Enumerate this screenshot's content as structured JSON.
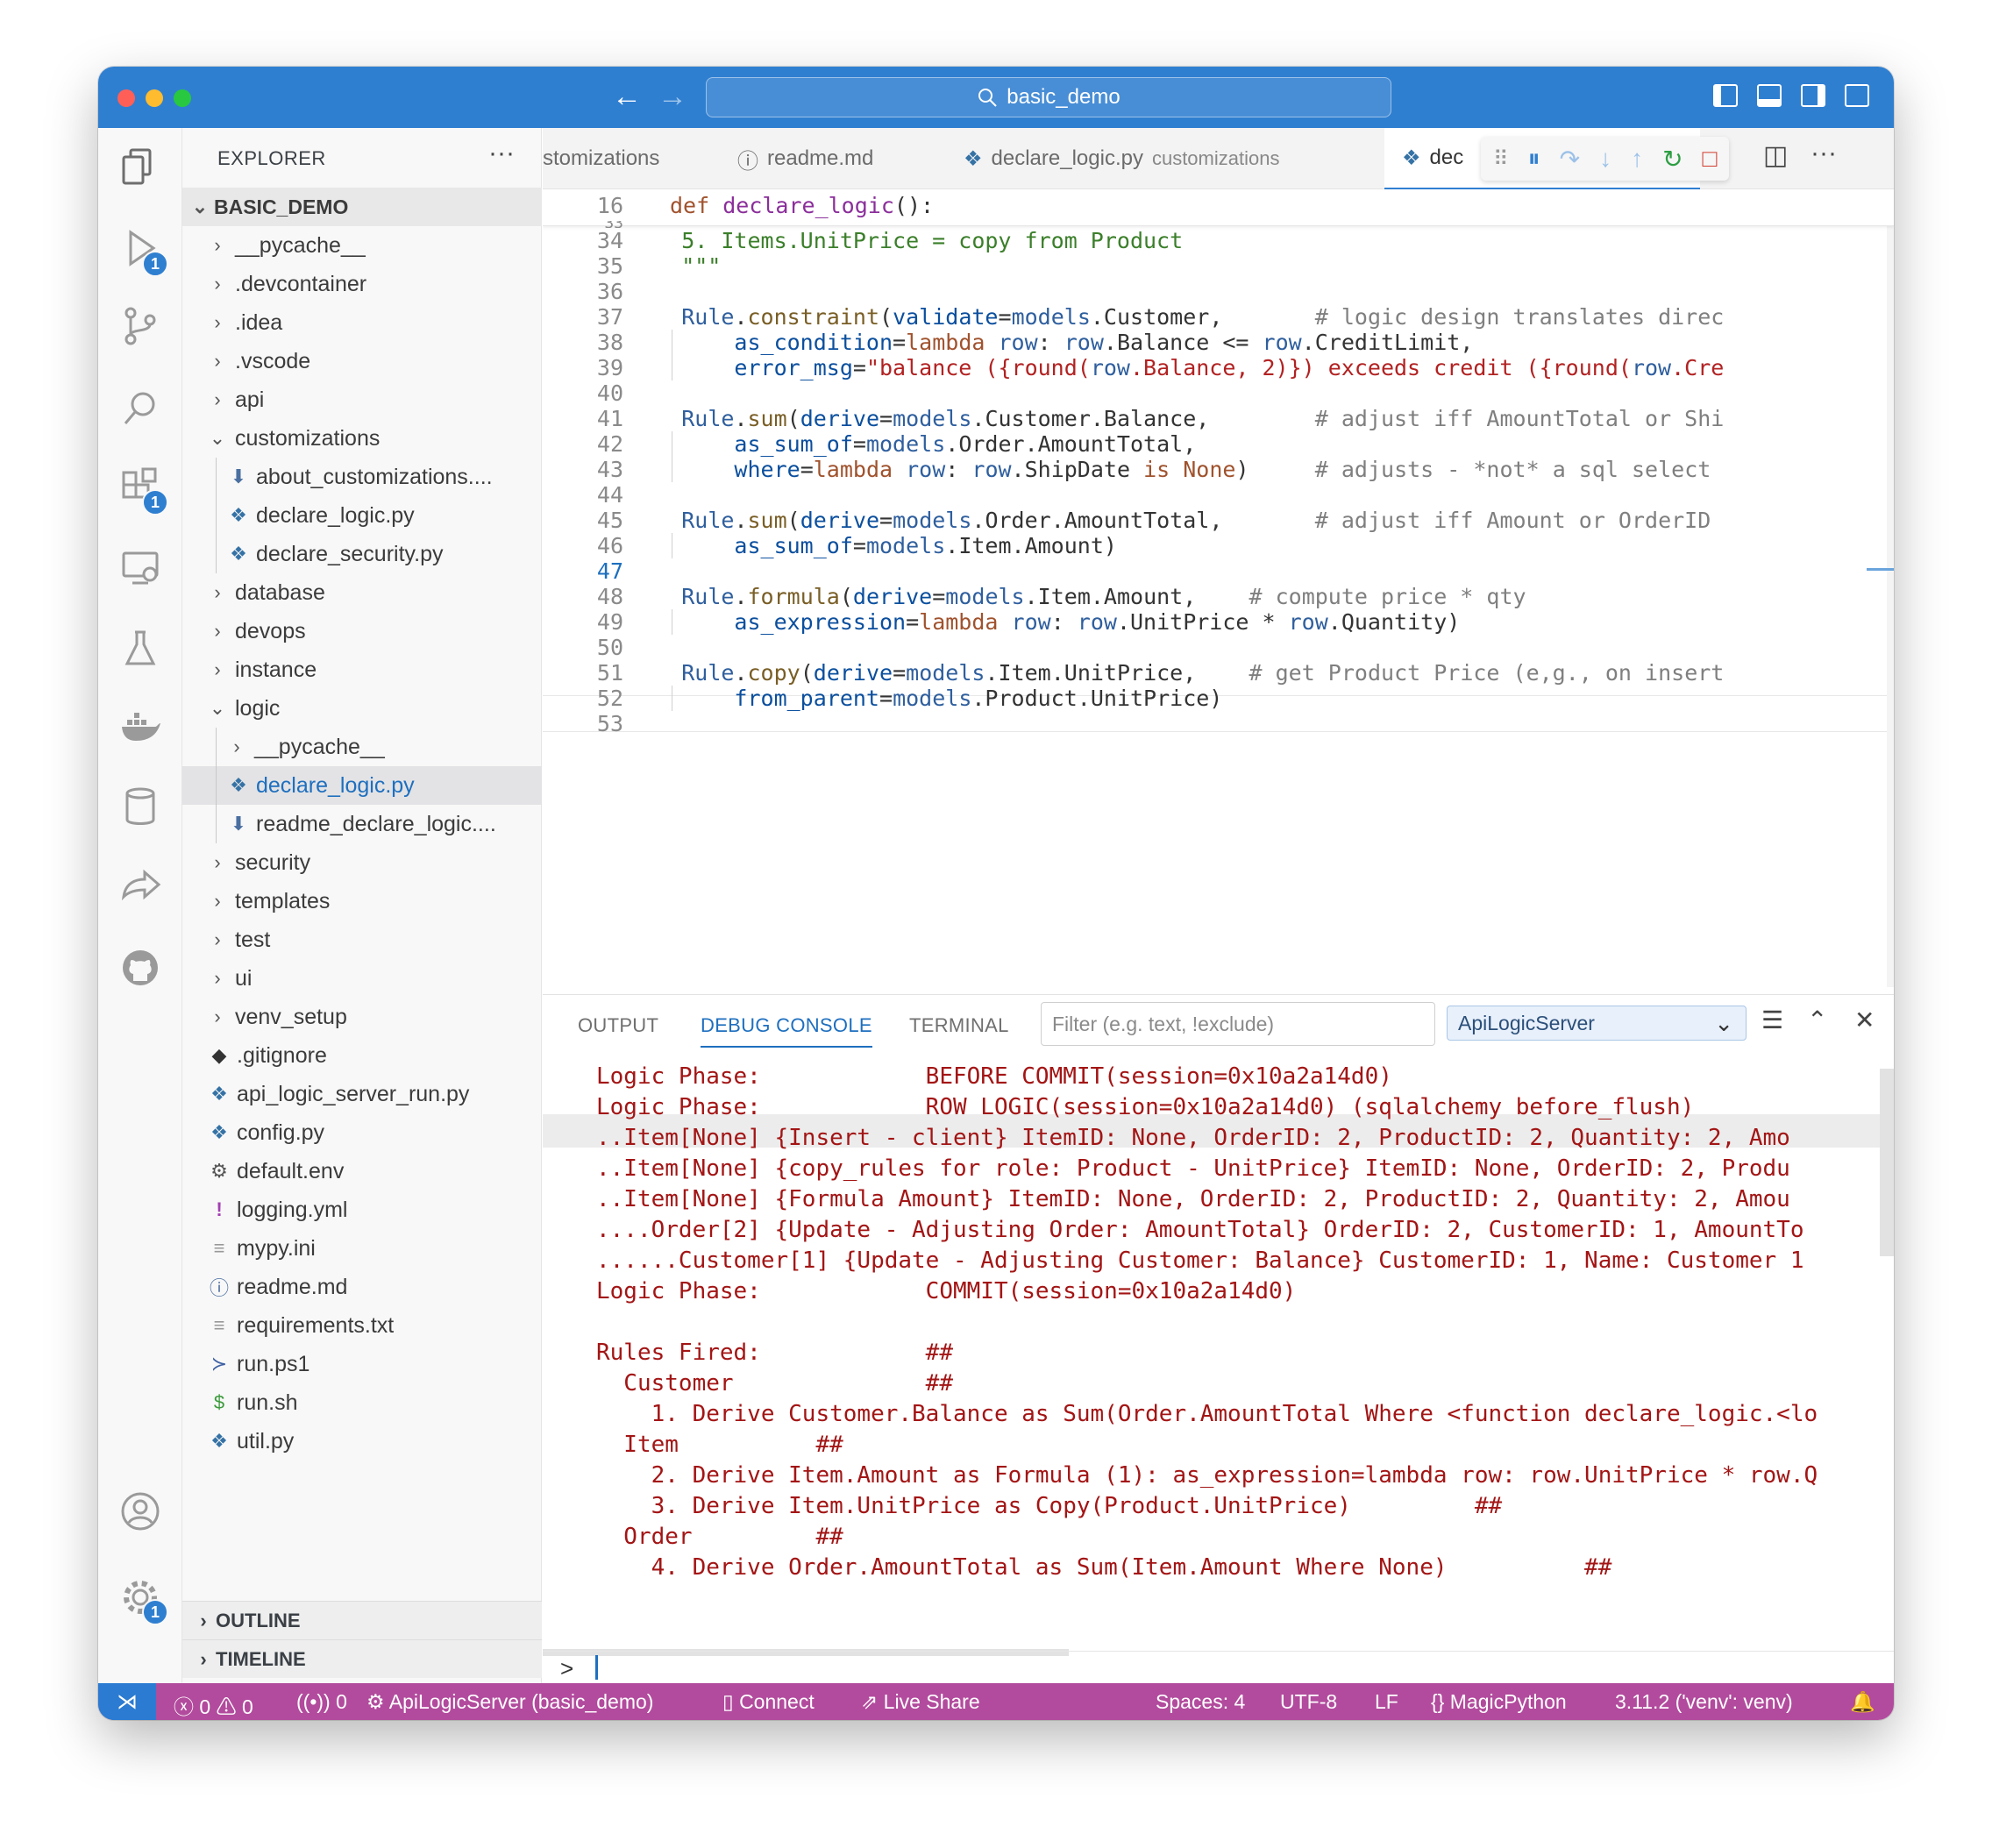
{
  "window": {
    "search_text": "basic_demo",
    "colors": {
      "titlebar": "#2f7fd1",
      "statusbar": "#b24b9d",
      "close": "#ff5f57",
      "minimize": "#febc2e",
      "maximize": "#28c840"
    }
  },
  "activity_bar": {
    "icons": [
      "explorer-icon",
      "run-debug-icon",
      "source-control-icon",
      "search-icon",
      "extensions-icon",
      "remote-explorer-icon",
      "testing-icon",
      "docker-icon",
      "database-icon",
      "live-share-icon",
      "github-icon",
      "accounts-icon",
      "manage-gear-icon"
    ],
    "debug_badge": "1",
    "extensions_badge": "1",
    "manage_badge": "1"
  },
  "explorer": {
    "title": "EXPLORER",
    "more": "···",
    "root": "BASIC_DEMO",
    "items": [
      {
        "label": "__pycache__",
        "kind": "folder"
      },
      {
        "label": ".devcontainer",
        "kind": "folder"
      },
      {
        "label": ".idea",
        "kind": "folder"
      },
      {
        "label": ".vscode",
        "kind": "folder"
      },
      {
        "label": "api",
        "kind": "folder"
      },
      {
        "label": "customizations",
        "kind": "folder-open"
      },
      {
        "label": "about_customizations....",
        "kind": "md"
      },
      {
        "label": "declare_logic.py",
        "kind": "py"
      },
      {
        "label": "declare_security.py",
        "kind": "py"
      },
      {
        "label": "database",
        "kind": "folder"
      },
      {
        "label": "devops",
        "kind": "folder"
      },
      {
        "label": "instance",
        "kind": "folder"
      },
      {
        "label": "logic",
        "kind": "folder-open"
      },
      {
        "label": "__pycache__",
        "kind": "folder"
      },
      {
        "label": "declare_logic.py",
        "kind": "py"
      },
      {
        "label": "readme_declare_logic....",
        "kind": "md"
      },
      {
        "label": "security",
        "kind": "folder"
      },
      {
        "label": "templates",
        "kind": "folder"
      },
      {
        "label": "test",
        "kind": "folder"
      },
      {
        "label": "ui",
        "kind": "folder"
      },
      {
        "label": "venv_setup",
        "kind": "folder"
      },
      {
        "label": ".gitignore",
        "kind": "git"
      },
      {
        "label": "api_logic_server_run.py",
        "kind": "py"
      },
      {
        "label": "config.py",
        "kind": "py"
      },
      {
        "label": "default.env",
        "kind": "gear"
      },
      {
        "label": "logging.yml",
        "kind": "yml"
      },
      {
        "label": "mypy.ini",
        "kind": "ini"
      },
      {
        "label": "readme.md",
        "kind": "info"
      },
      {
        "label": "requirements.txt",
        "kind": "ini"
      },
      {
        "label": "run.ps1",
        "kind": "ps"
      },
      {
        "label": "run.sh",
        "kind": "sh"
      },
      {
        "label": "util.py",
        "kind": "py"
      }
    ],
    "outline": "OUTLINE",
    "timeline": "TIMELINE"
  },
  "tabs": [
    {
      "label": "stomizations",
      "desc": ""
    },
    {
      "label": "readme.md",
      "desc": ""
    },
    {
      "label": "declare_logic.py",
      "desc": "customizations"
    },
    {
      "label": "dec",
      "desc": ""
    }
  ],
  "editor": {
    "sticky": {
      "ln": "16",
      "text": "def declare_logic():"
    },
    "sticky_under": "33",
    "current_line": "47",
    "lines": [
      {
        "ln": "34",
        "text": "    5. Items.UnitPrice = copy from Product"
      },
      {
        "ln": "35",
        "text": "    \"\"\""
      },
      {
        "ln": "36",
        "text": ""
      },
      {
        "ln": "37",
        "text": "    Rule.constraint(validate=models.Customer,       # logic design translates direc"
      },
      {
        "ln": "38",
        "text": "        as_condition=lambda row: row.Balance <= row.CreditLimit,"
      },
      {
        "ln": "39",
        "text": "        error_msg=\"balance ({round(row.Balance, 2)}) exceeds credit ({round(row.Cre"
      },
      {
        "ln": "40",
        "text": ""
      },
      {
        "ln": "41",
        "text": "    Rule.sum(derive=models.Customer.Balance,        # adjust iff AmountTotal or Shi"
      },
      {
        "ln": "42",
        "text": "        as_sum_of=models.Order.AmountTotal,"
      },
      {
        "ln": "43",
        "text": "        where=lambda row: row.ShipDate is None)     # adjusts - *not* a sql select"
      },
      {
        "ln": "44",
        "text": ""
      },
      {
        "ln": "45",
        "text": "    Rule.sum(derive=models.Order.AmountTotal,       # adjust iff Amount or OrderID"
      },
      {
        "ln": "46",
        "text": "        as_sum_of=models.Item.Amount)"
      },
      {
        "ln": "47",
        "text": ""
      },
      {
        "ln": "48",
        "text": "    Rule.formula(derive=models.Item.Amount,    # compute price * qty"
      },
      {
        "ln": "49",
        "text": "        as_expression=lambda row: row.UnitPrice * row.Quantity)"
      },
      {
        "ln": "50",
        "text": ""
      },
      {
        "ln": "51",
        "text": "    Rule.copy(derive=models.Item.UnitPrice,    # get Product Price (e,g., on insert"
      },
      {
        "ln": "52",
        "text": "        from_parent=models.Product.UnitPrice)"
      },
      {
        "ln": "53",
        "text": ""
      }
    ]
  },
  "panel": {
    "tabs": [
      "OUTPUT",
      "DEBUG CONSOLE",
      "TERMINAL"
    ],
    "filter_placeholder": "Filter (e.g. text, !exclude)",
    "select_value": "ApiLogicServer",
    "console": [
      "Logic Phase:            BEFORE COMMIT(session=0x10a2a14d0)",
      "Logic Phase:            ROW LOGIC(session=0x10a2a14d0) (sqlalchemy before_flush)",
      "..Item[None] {Insert - client} ItemID: None, OrderID: 2, ProductID: 2, Quantity: 2, Amo",
      "..Item[None] {copy_rules for role: Product - UnitPrice} ItemID: None, OrderID: 2, Produ",
      "..Item[None] {Formula Amount} ItemID: None, OrderID: 2, ProductID: 2, Quantity: 2, Amou",
      "....Order[2] {Update - Adjusting Order: AmountTotal} OrderID: 2, CustomerID: 1, AmountTo",
      "......Customer[1] {Update - Adjusting Customer: Balance} CustomerID: 1, Name: Customer 1",
      "Logic Phase:            COMMIT(session=0x10a2a14d0)",
      "",
      "Rules Fired:            ##",
      "  Customer              ##",
      "    1. Derive Customer.Balance as Sum(Order.AmountTotal Where <function declare_logic.<lo",
      "  Item          ##",
      "    2. Derive Item.Amount as Formula (1): as_expression=lambda row: row.UnitPrice * row.Q",
      "    3. Derive Item.UnitPrice as Copy(Product.UnitPrice)         ##",
      "  Order         ##",
      "    4. Derive Order.AmountTotal as Sum(Item.Amount Where None)          ##"
    ],
    "prompt": ">"
  },
  "status": {
    "errors": "0",
    "warnings": "0",
    "ports": "0",
    "debug_target": "ApiLogicServer (basic_demo)",
    "connect": "Connect",
    "live_share": "Live Share",
    "spaces": "Spaces: 4",
    "encoding": "UTF-8",
    "eol": "LF",
    "language": "MagicPython",
    "interpreter": "3.11.2 ('venv': venv)"
  }
}
